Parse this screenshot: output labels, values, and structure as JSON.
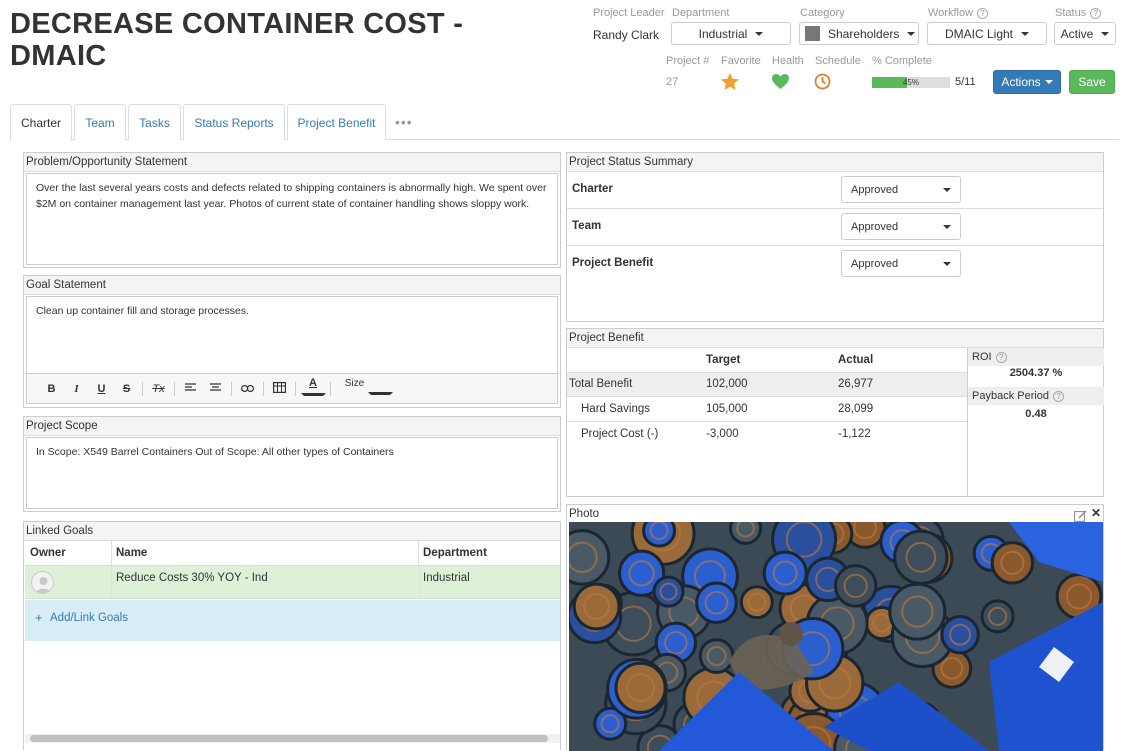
{
  "title": "DECREASE CONTAINER COST - DMAIC",
  "header": {
    "project_leader": {
      "label": "Project Leader",
      "value": "Randy Clark"
    },
    "department": {
      "label": "Department",
      "value": "Industrial"
    },
    "category": {
      "label": "Category",
      "value": "Shareholders",
      "swatch": "#777777"
    },
    "workflow": {
      "label": "Workflow",
      "value": "DMAIC Light"
    },
    "status": {
      "label": "Status",
      "value": "Active"
    },
    "project_num": {
      "label": "Project #",
      "value": "27"
    },
    "favorite": {
      "label": "Favorite",
      "icon": "star-icon",
      "color": "#f0a030"
    },
    "health": {
      "label": "Health",
      "icon": "heart-icon",
      "color": "#5cb85c"
    },
    "schedule": {
      "label": "Schedule",
      "icon": "clock-icon",
      "color": "#d9822b"
    },
    "complete": {
      "label": "% Complete",
      "percent_text": "45%",
      "fraction": 0.45,
      "count": "5/11"
    },
    "actions_label": "Actions",
    "save_label": "Save",
    "help_glyph": "?"
  },
  "tabs": [
    "Charter",
    "Team",
    "Tasks",
    "Status Reports",
    "Project Benefit"
  ],
  "tabs_more": "•••",
  "problem": {
    "title": "Problem/Opportunity Statement",
    "text": "Over the last several years costs and defects related to shipping containers is abnormally high. We spent over $2M on container management last year. Photos of current state of container handling shows sloppy work."
  },
  "goal": {
    "title": "Goal Statement",
    "text": "Clean up container fill and storage processes.",
    "toolbar": {
      "bold": "B",
      "italic": "I",
      "underline": "U",
      "strike": "S",
      "clear": "Tx",
      "font_color": "A",
      "size": "Size"
    }
  },
  "scope": {
    "title": "Project Scope",
    "text": "In Scope: X549 Barrel Containers Out of Scope: All other types of Containers"
  },
  "linked_goals": {
    "title": "Linked Goals",
    "columns": [
      "Owner",
      "Name",
      "Department"
    ],
    "rows": [
      {
        "name": "Reduce Costs 30% YOY - Ind",
        "department": "Industrial"
      }
    ],
    "add_label": "Add/Link Goals",
    "add_glyph": "+"
  },
  "status_summary": {
    "title": "Project Status Summary",
    "rows": [
      {
        "label": "Charter",
        "value": "Approved"
      },
      {
        "label": "Team",
        "value": "Approved"
      },
      {
        "label": "Project Benefit",
        "value": "Approved"
      }
    ]
  },
  "benefit": {
    "title": "Project Benefit",
    "col_target": "Target",
    "col_actual": "Actual",
    "rows": [
      {
        "label": "Total Benefit",
        "target": "102,000",
        "actual": "26,977"
      },
      {
        "label": "Hard Savings",
        "target": "105,000",
        "actual": "28,099"
      },
      {
        "label": "Project Cost (-)",
        "target": "-3,000",
        "actual": "-1,122"
      }
    ],
    "roi_label": "ROI",
    "roi_value": "2504.37 %",
    "payback_label": "Payback Period",
    "payback_value": "0.48"
  },
  "photo": {
    "title": "Photo",
    "edit_icon": "edit-icon",
    "close_glyph": "✕"
  }
}
